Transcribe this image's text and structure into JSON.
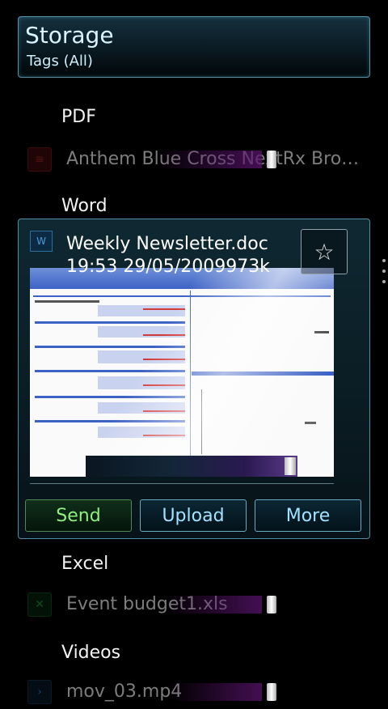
{
  "header": {
    "title": "Storage",
    "subtitle": "Tags (All)"
  },
  "sections": [
    {
      "label": "PDF",
      "items": [
        {
          "name": "Anthem Blue Cross NextRx Bro…",
          "icon": "pdf-icon"
        }
      ]
    },
    {
      "label": "Word"
    },
    {
      "label": "Excel",
      "items": [
        {
          "name": "Event budget1.xls",
          "icon": "excel-icon"
        }
      ]
    },
    {
      "label": "Videos",
      "items": [
        {
          "name": "mov_03.mp4",
          "icon": "video-icon"
        }
      ]
    }
  ],
  "popup": {
    "file_name": "Weekly Newsletter.doc",
    "file_meta": "19:53 29/05/2009973k",
    "star_label": "☆",
    "doc_icon_glyph": "W",
    "buttons": {
      "send": "Send",
      "upload": "Upload",
      "more": "More"
    }
  },
  "colors": {
    "accent_cyan": "#a3e3ff",
    "send_green": "#8ff07f",
    "border_blue": "#4f8ea6"
  }
}
